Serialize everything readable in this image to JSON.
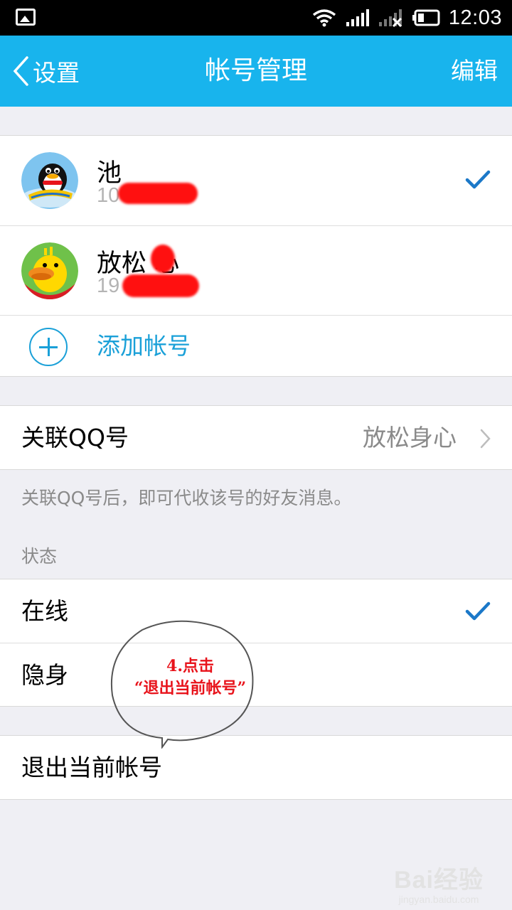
{
  "status_bar": {
    "time": "12:03",
    "icons": [
      "image-icon",
      "wifi-icon",
      "signal-icon",
      "no-signal-icon",
      "battery-icon"
    ]
  },
  "nav": {
    "back_label": "设置",
    "title": "帐号管理",
    "edit_label": "编辑"
  },
  "accounts": [
    {
      "name": "池",
      "number": "10        07",
      "current": true,
      "avatar": "qq-penguin"
    },
    {
      "name": "放松  心",
      "number": "19         93",
      "current": false,
      "avatar": "duck"
    }
  ],
  "add_account_label": "添加帐号",
  "link_qq": {
    "label": "关联QQ号",
    "value": "放松身心",
    "hint": "关联QQ号后，即可代收该号的好友消息。"
  },
  "status_section": {
    "header": "状态",
    "options": [
      {
        "label": "在线",
        "selected": true
      },
      {
        "label": "隐身",
        "selected": false
      }
    ]
  },
  "logout_label": "退出当前帐号",
  "annotation": {
    "line1": "4.点击",
    "line2": "“退出当前帐号”"
  },
  "watermark": {
    "logo": "Bai经验",
    "url": "jingyan.baidu.com"
  },
  "colors": {
    "nav_bg": "#18b4ed",
    "accent": "#1aa0d8",
    "check": "#1b78c8",
    "annotation": "#e8131b"
  }
}
